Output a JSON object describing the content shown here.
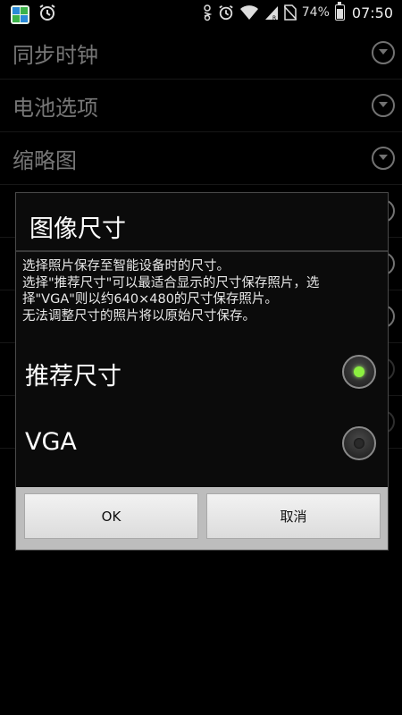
{
  "status_bar": {
    "battery": "74%",
    "time": "07:50",
    "icons": [
      "app-icon",
      "alarm-icon",
      "data-icon",
      "alarm-icon",
      "wifi-icon",
      "signal-icon",
      "no-sim-icon",
      "battery-icon"
    ]
  },
  "background_list": {
    "items": [
      {
        "label": "同步时钟",
        "control": "dropdown"
      },
      {
        "label": "电池选项",
        "control": "dropdown"
      },
      {
        "label": "缩略图",
        "control": "dropdown"
      },
      {
        "label": "",
        "control": "dropdown"
      },
      {
        "label": "",
        "control": "dropdown"
      },
      {
        "label": "",
        "control": "dropdown"
      },
      {
        "label": "",
        "control": "radio"
      },
      {
        "label": "",
        "control": "radio"
      }
    ]
  },
  "dialog": {
    "title": "图像尺寸",
    "message_lines": [
      "选择照片保存至智能设备时的尺寸。",
      " 选择\"推荐尺寸\"可以最适合显示的尺寸保存照片，选",
      "择\"VGA\"则以约640×480的尺寸保存照片。",
      " 无法调整尺寸的照片将以原始尺寸保存。"
    ],
    "options": [
      {
        "label": "推荐尺寸",
        "selected": true
      },
      {
        "label": "VGA",
        "selected": false
      }
    ],
    "ok_label": "OK",
    "cancel_label": "取消"
  }
}
